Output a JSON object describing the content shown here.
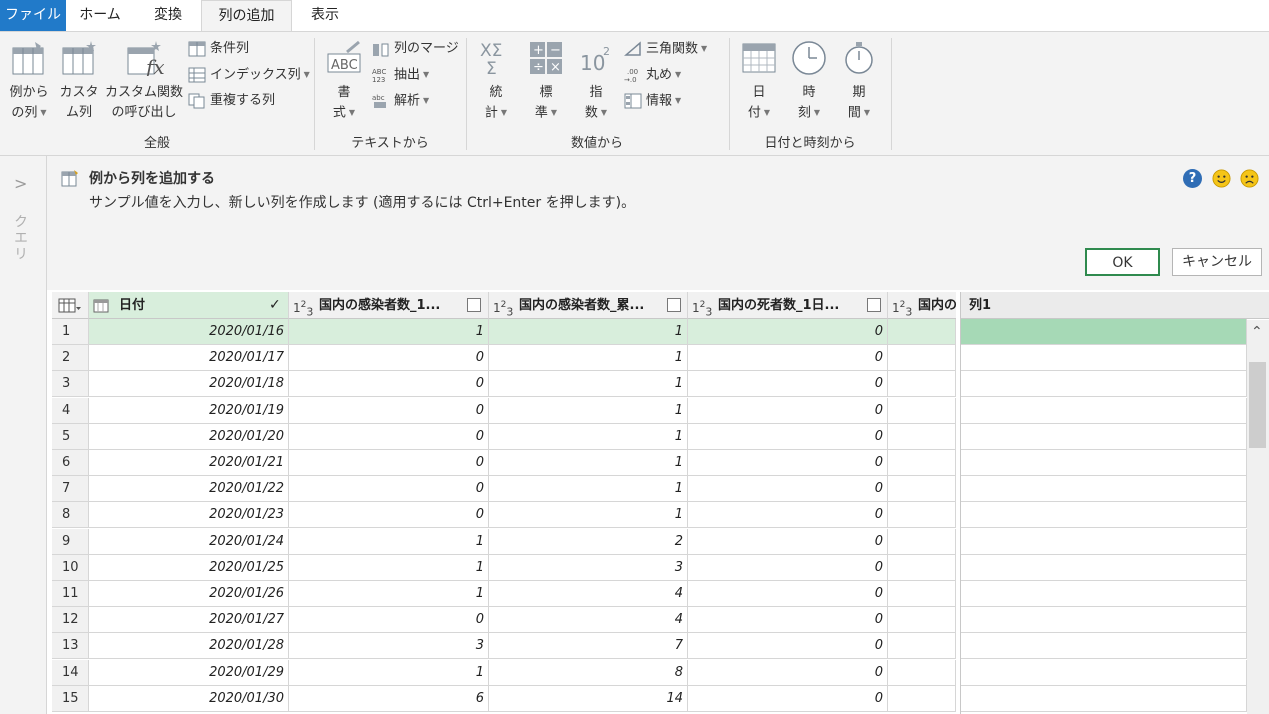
{
  "tabs": [
    {
      "label": "ファイル",
      "state": "file"
    },
    {
      "label": "ホーム",
      "state": ""
    },
    {
      "label": "変換",
      "state": ""
    },
    {
      "label": "列の追加",
      "state": "active"
    },
    {
      "label": "表示",
      "state": ""
    }
  ],
  "ribbon": {
    "general": {
      "group_label": "全般",
      "from_examples_l1": "例から",
      "from_examples_l2": "の列",
      "custom_col_l1": "カスタ",
      "custom_col_l2": "ム列",
      "invoke_fn_l1": "カスタム関数",
      "invoke_fn_l2": "の呼び出し",
      "conditional": "条件列",
      "index": "インデックス列",
      "duplicate": "重複する列"
    },
    "text": {
      "group_label": "テキストから",
      "format_l1": "書",
      "format_l2": "式",
      "merge": "列のマージ",
      "extract": "抽出",
      "parse": "解析"
    },
    "number": {
      "group_label": "数値から",
      "stats_l1": "統",
      "stats_l2": "計",
      "standard_l1": "標",
      "standard_l2": "準",
      "sci_l1": "指",
      "sci_l2": "数",
      "trig": "三角関数",
      "round": "丸め",
      "info": "情報"
    },
    "datetime": {
      "group_label": "日付と時刻から",
      "date_l1": "日",
      "date_l2": "付",
      "time_l1": "時",
      "time_l2": "刻",
      "duration_l1": "期",
      "duration_l2": "間"
    }
  },
  "query_pane": {
    "label": "クエリ"
  },
  "examples": {
    "title": "例から列を追加する",
    "description": "サンプル値を入力し、新しい列を作成します (適用するには Ctrl+Enter を押します)。",
    "ok": "OK",
    "cancel": "キャンセル",
    "help": "?"
  },
  "grid": {
    "columns": [
      {
        "type": "date",
        "name": "日付",
        "checked": true
      },
      {
        "type": "123",
        "name": "国内の感染者数_1...",
        "checked": false
      },
      {
        "type": "123",
        "name": "国内の感染者数_累...",
        "checked": false
      },
      {
        "type": "123",
        "name": "国内の死者数_1日...",
        "checked": false
      },
      {
        "type": "123",
        "name": "国内の",
        "checked": false
      }
    ],
    "rows": [
      {
        "idx": "1",
        "date": "2020/01/16",
        "a": "1",
        "b": "1",
        "c": "0"
      },
      {
        "idx": "2",
        "date": "2020/01/17",
        "a": "0",
        "b": "1",
        "c": "0"
      },
      {
        "idx": "3",
        "date": "2020/01/18",
        "a": "0",
        "b": "1",
        "c": "0"
      },
      {
        "idx": "4",
        "date": "2020/01/19",
        "a": "0",
        "b": "1",
        "c": "0"
      },
      {
        "idx": "5",
        "date": "2020/01/20",
        "a": "0",
        "b": "1",
        "c": "0"
      },
      {
        "idx": "6",
        "date": "2020/01/21",
        "a": "0",
        "b": "1",
        "c": "0"
      },
      {
        "idx": "7",
        "date": "2020/01/22",
        "a": "0",
        "b": "1",
        "c": "0"
      },
      {
        "idx": "8",
        "date": "2020/01/23",
        "a": "0",
        "b": "1",
        "c": "0"
      },
      {
        "idx": "9",
        "date": "2020/01/24",
        "a": "1",
        "b": "2",
        "c": "0"
      },
      {
        "idx": "10",
        "date": "2020/01/25",
        "a": "1",
        "b": "3",
        "c": "0"
      },
      {
        "idx": "11",
        "date": "2020/01/26",
        "a": "1",
        "b": "4",
        "c": "0"
      },
      {
        "idx": "12",
        "date": "2020/01/27",
        "a": "0",
        "b": "4",
        "c": "0"
      },
      {
        "idx": "13",
        "date": "2020/01/28",
        "a": "3",
        "b": "7",
        "c": "0"
      },
      {
        "idx": "14",
        "date": "2020/01/29",
        "a": "1",
        "b": "8",
        "c": "0"
      },
      {
        "idx": "15",
        "date": "2020/01/30",
        "a": "6",
        "b": "14",
        "c": "0"
      }
    ]
  },
  "example_column": {
    "name": "列1"
  },
  "colors": {
    "file_tab": "#217ac9",
    "selected_row": "#d8eedc",
    "example_cell": "#a6d9b6",
    "ok_border": "#2f8a4e"
  }
}
